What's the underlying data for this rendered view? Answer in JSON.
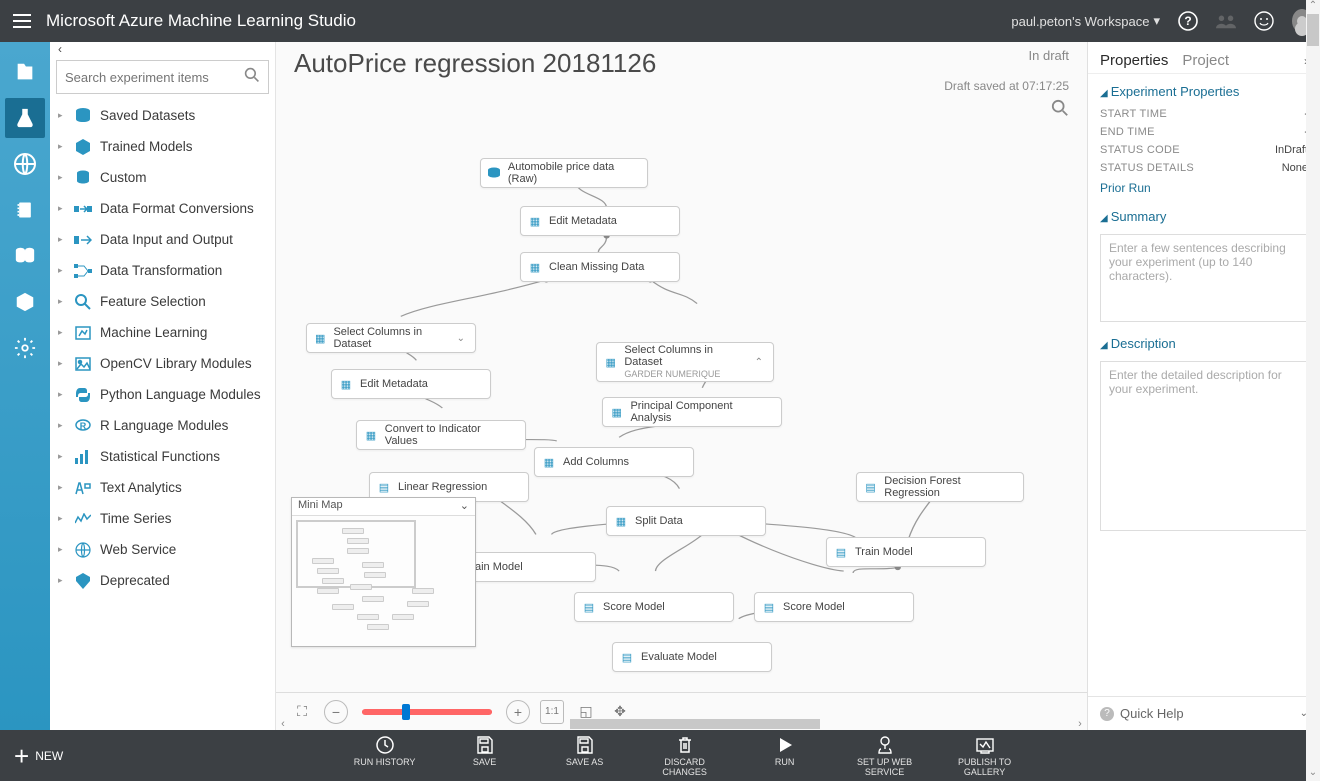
{
  "header": {
    "brand": "Microsoft Azure Machine Learning Studio",
    "workspace": "paul.peton's Workspace"
  },
  "palette": {
    "search_placeholder": "Search experiment items",
    "items": [
      {
        "label": "Saved Datasets"
      },
      {
        "label": "Trained Models"
      },
      {
        "label": "Custom"
      },
      {
        "label": "Data Format Conversions"
      },
      {
        "label": "Data Input and Output"
      },
      {
        "label": "Data Transformation"
      },
      {
        "label": "Feature Selection"
      },
      {
        "label": "Machine Learning"
      },
      {
        "label": "OpenCV Library Modules"
      },
      {
        "label": "Python Language Modules"
      },
      {
        "label": "R Language Modules"
      },
      {
        "label": "Statistical Functions"
      },
      {
        "label": "Text Analytics"
      },
      {
        "label": "Time Series"
      },
      {
        "label": "Web Service"
      },
      {
        "label": "Deprecated"
      }
    ]
  },
  "canvas": {
    "title": "AutoPrice regression 20181126",
    "status": "In draft",
    "saved": "Draft saved at 07:17:25",
    "minimap_title": "Mini Map",
    "nodes": {
      "n0": "Automobile price data (Raw)",
      "n1": "Edit Metadata",
      "n2": "Clean Missing Data",
      "n3": "Select Columns in Dataset",
      "n4": "Edit Metadata",
      "n5": "Convert to Indicator Values",
      "n6": "Select Columns in Dataset",
      "n6s": "GARDER NUMERIQUE",
      "n7": "Principal Component Analysis",
      "n8": "Add Columns",
      "n9": "Linear Regression",
      "n10": "Decision Forest Regression",
      "n11": "Split Data",
      "n12": "Train Model",
      "n13": "Train Model",
      "n14": "Score Model",
      "n15": "Score Model",
      "n16": "Evaluate Model"
    }
  },
  "properties": {
    "tabs": {
      "properties": "Properties",
      "project": "Project"
    },
    "experiment_head": "Experiment Properties",
    "rows": [
      {
        "key": "START TIME",
        "val": "-"
      },
      {
        "key": "END TIME",
        "val": "-"
      },
      {
        "key": "STATUS CODE",
        "val": "InDraft"
      },
      {
        "key": "STATUS DETAILS",
        "val": "None"
      }
    ],
    "prior_run": "Prior Run",
    "summary_head": "Summary",
    "summary_placeholder": "Enter a few sentences describing your experiment (up to 140 characters).",
    "description_head": "Description",
    "description_placeholder": "Enter the detailed description for your experiment.",
    "quick_help": "Quick Help"
  },
  "footer": {
    "new": "NEW",
    "actions": [
      "RUN HISTORY",
      "SAVE",
      "SAVE AS",
      "DISCARD CHANGES",
      "RUN",
      "SET UP WEB SERVICE",
      "PUBLISH TO GALLERY"
    ]
  }
}
